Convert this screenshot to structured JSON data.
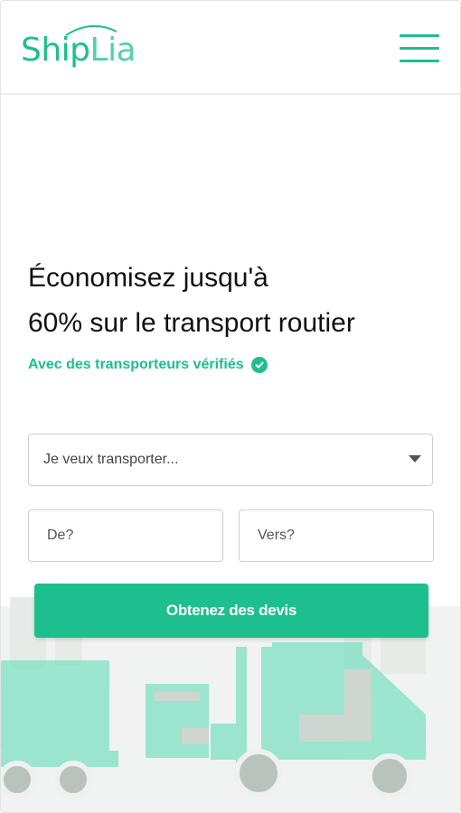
{
  "brand": {
    "logo_part1": "Ship",
    "logo_part2": "Lia",
    "accent_color": "#1dbf8e"
  },
  "header": {
    "menu_icon": "hamburger-menu-icon"
  },
  "hero": {
    "title_line1": "Économisez jusqu'à",
    "title_line2": "60% sur le transport routier",
    "subtitle": "Avec des transporteurs vérifiés",
    "subtitle_icon": "check-circle-icon"
  },
  "form": {
    "cargo_select_placeholder": "Je veux transporter...",
    "from_placeholder": "De?",
    "to_placeholder": "Vers?",
    "submit_label": "Obtenez des devis"
  },
  "illustration": {
    "name": "forklift-and-truck-illustration"
  }
}
